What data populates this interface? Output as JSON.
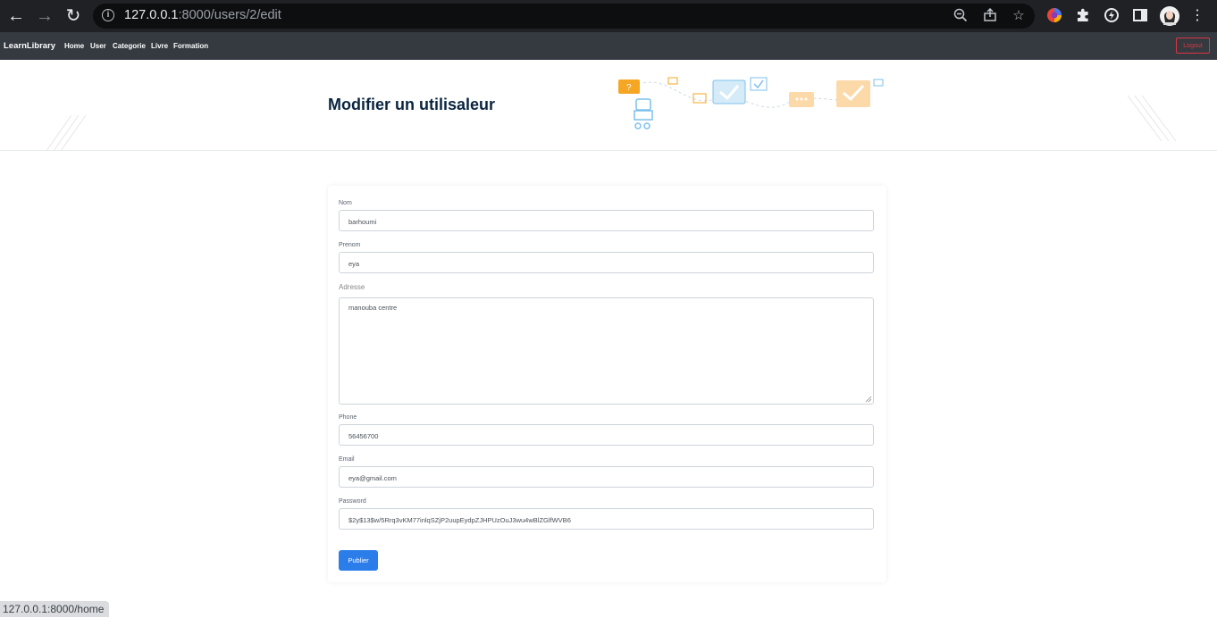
{
  "browser": {
    "url_host": "127.0.0.1",
    "url_rest": ":8000/users/2/edit",
    "status_url": "127.0.0.1:8000/home"
  },
  "navbar": {
    "brand": "LearnLibrary",
    "links": [
      "Home",
      "User",
      "Categorie",
      "Livre",
      "Formation"
    ],
    "logout": "Logout"
  },
  "header": {
    "title": "Modifier un utilisaleur"
  },
  "form": {
    "nom_label": "Nom",
    "nom_value": "barhoumi",
    "prenom_label": "Prenom",
    "prenom_value": "eya",
    "adresse_label": "Adresse",
    "adresse_value": "manouba centre",
    "phone_label": "Phone",
    "phone_value": "56456700",
    "email_label": "Email",
    "email_value": "eya@gmail.com",
    "password_label": "Password",
    "password_value": "$2y$13$w/5Rrq3vKM77inlqSZjP2uupEydpZJHPUzOuJ3wu4wBlZGlfWVB6",
    "submit": "Publier"
  },
  "colors": {
    "navbar": "#343a40",
    "primary": "#2b7de9",
    "danger": "#dc3545",
    "title": "#0a2540"
  }
}
